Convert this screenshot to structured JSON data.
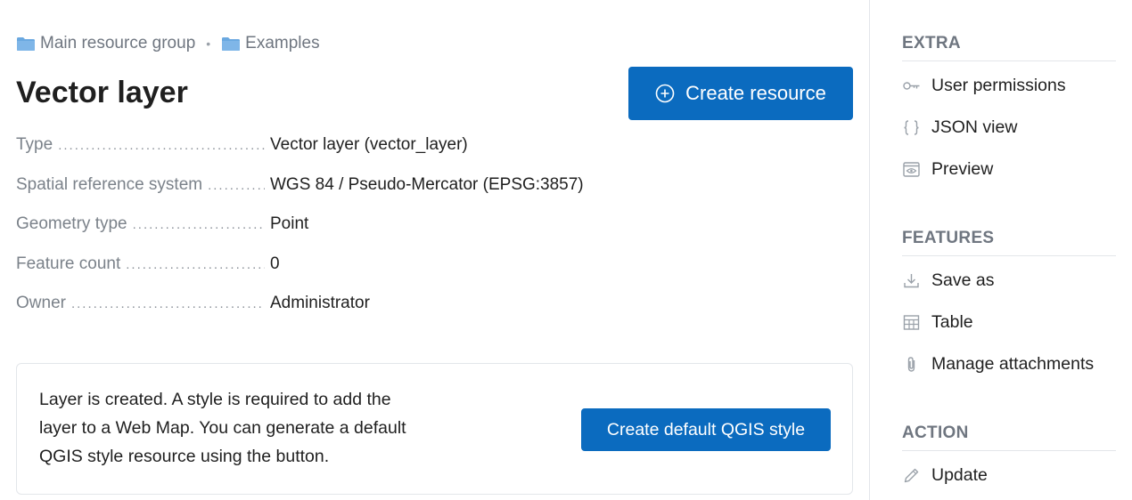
{
  "breadcrumb": {
    "items": [
      {
        "label": "Main resource group",
        "icon": "folder-icon"
      },
      {
        "label": "Examples",
        "icon": "folder-icon"
      }
    ],
    "separator": "•"
  },
  "page": {
    "title": "Vector layer",
    "create_button": "Create resource"
  },
  "properties": [
    {
      "key": "Type",
      "value": "Vector layer (vector_layer)"
    },
    {
      "key": "Spatial reference system",
      "value": "WGS 84 / Pseudo-Mercator (EPSG:3857)"
    },
    {
      "key": "Geometry type",
      "value": "Point"
    },
    {
      "key": "Feature count",
      "value": "0"
    },
    {
      "key": "Owner",
      "value": "Administrator"
    }
  ],
  "notice": {
    "text": "Layer is created. A style is required to add the layer to a Web Map. You can generate a default QGIS style resource using the button.",
    "button": "Create default QGIS style"
  },
  "sidebar": {
    "extra": {
      "title": "EXTRA",
      "items": [
        {
          "label": "User permissions",
          "icon": "key-icon"
        },
        {
          "label": "JSON view",
          "icon": "braces-icon"
        },
        {
          "label": "Preview",
          "icon": "preview-icon"
        }
      ]
    },
    "features": {
      "title": "FEATURES",
      "items": [
        {
          "label": "Save as",
          "icon": "download-icon"
        },
        {
          "label": "Table",
          "icon": "table-icon"
        },
        {
          "label": "Manage attachments",
          "icon": "paperclip-icon"
        }
      ]
    },
    "action": {
      "title": "ACTION",
      "items": [
        {
          "label": "Update",
          "icon": "pencil-icon"
        }
      ]
    }
  },
  "colors": {
    "primary": "#0b6bbf",
    "folder": "#6aa8e0",
    "muted_text": "#6f7680",
    "icon_gray": "#9aa1a9"
  }
}
